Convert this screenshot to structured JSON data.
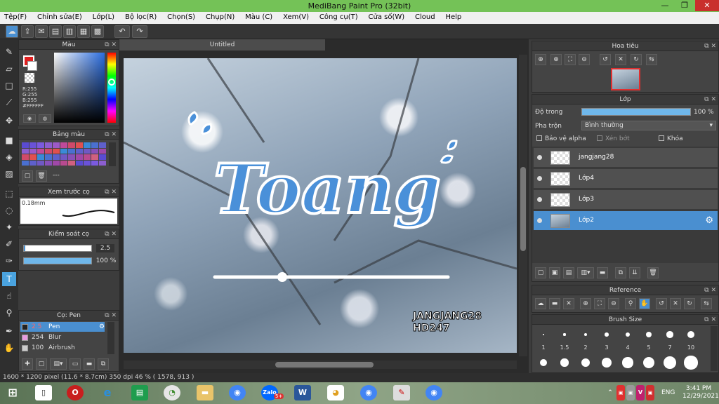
{
  "window": {
    "title": "MediBang Paint Pro (32bit)",
    "minimize": "—",
    "restore": "❐",
    "close": "✕"
  },
  "menu": [
    "Tệp(F)",
    "Chỉnh sửa(E)",
    "Lớp(L)",
    "Bộ lọc(R)",
    "Chọn(S)",
    "Chụp(N)",
    "Màu (C)",
    "Xem(V)",
    "Công cụ(T)",
    "Cửa số(W)",
    "Cloud",
    "Help"
  ],
  "color_panel": {
    "title": "Màu",
    "r": "R:255",
    "g": "G:255",
    "b": "B:255",
    "hex": "#FFFFFF"
  },
  "palette_panel": {
    "title": "Bảng màu",
    "label": "---"
  },
  "brush_preview": {
    "title": "Xem trước cọ",
    "size": "0.18mm"
  },
  "brush_control": {
    "title": "Kiểm soát cọ",
    "size_value": "2.5",
    "opacity_value": "100 %"
  },
  "brush_panel": {
    "title": "Cọ: Pen",
    "items": [
      {
        "size": "2.5",
        "name": "Pen"
      },
      {
        "size": "254",
        "name": "Blur"
      },
      {
        "size": "100",
        "name": "Airbrush"
      }
    ]
  },
  "document": {
    "tab": "Untitled"
  },
  "artwork": {
    "headline": "Toang",
    "signature_line1": "JANGJANG28",
    "signature_line2": "HD247"
  },
  "navigator": {
    "title": "Hoa tiêu"
  },
  "layers": {
    "title": "Lớp",
    "opacity_label": "Độ trong",
    "opacity_value": "100 %",
    "blend_label": "Pha trộn",
    "blend_value": "Bình thường",
    "protect_alpha": "Bảo vệ alpha",
    "clipping": "Xén bớt",
    "lock": "Khóa",
    "items": [
      {
        "name": "jangjang28",
        "selected": false
      },
      {
        "name": "Lớp4",
        "selected": false
      },
      {
        "name": "Lớp3",
        "selected": false
      },
      {
        "name": "Lớp2",
        "selected": true
      }
    ]
  },
  "reference": {
    "title": "Reference"
  },
  "brush_size": {
    "title": "Brush Size",
    "labels": [
      "1",
      "1.5",
      "2",
      "3",
      "4",
      "5",
      "7",
      "10"
    ]
  },
  "status": {
    "text": "1600 * 1200 pixel  (11.6 * 8.7cm)  350 dpi  46 %  ( 1578, 913 )"
  },
  "taskbar": {
    "lang": "ENG",
    "time": "3:41 PM",
    "date": "12/29/2021",
    "zalo_badge": "5+"
  },
  "colors": {
    "accent": "#4a8fd0",
    "titlebar": "#74c257",
    "panel": "#444444",
    "headline_fill": "#4a90d9"
  }
}
